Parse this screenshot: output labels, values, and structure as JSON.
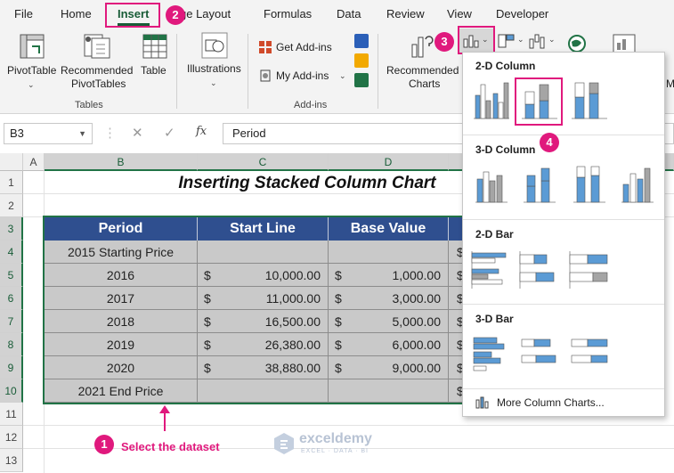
{
  "tabs": [
    "File",
    "Home",
    "Insert",
    "ge Layout",
    "Formulas",
    "Data",
    "Review",
    "View",
    "Developer"
  ],
  "ribbon": {
    "pivot_table": "PivotTable",
    "recommended_pivot": [
      "Recommended",
      "PivotTables"
    ],
    "table": "Table",
    "illustrations": "Illustrations",
    "get_addins": "Get Add-ins",
    "my_addins": "My Add-ins",
    "recommended_charts": [
      "Recommended",
      "Charts"
    ],
    "partial_label": "M",
    "group_tables": "Tables",
    "group_addins": "Add-ins"
  },
  "formula_bar": {
    "cell_ref": "B3",
    "value": "Period",
    "fx": "fx"
  },
  "grid": {
    "columns": [
      "A",
      "B",
      "C",
      "D"
    ],
    "rows": [
      "1",
      "2",
      "3",
      "4",
      "5",
      "6",
      "7",
      "8",
      "9",
      "10",
      "11",
      "12",
      "13"
    ],
    "title": "Inserting Stacked Column Chart"
  },
  "table": {
    "headers": [
      "Period",
      "Start Line",
      "Base Value"
    ],
    "currency": "$",
    "rows": [
      {
        "period": "2015 Starting Price",
        "start": "",
        "base": ""
      },
      {
        "period": "2016",
        "start": "10,000.00",
        "base": "1,000.00"
      },
      {
        "period": "2017",
        "start": "11,000.00",
        "base": "3,000.00"
      },
      {
        "period": "2018",
        "start": "16,500.00",
        "base": "5,000.00"
      },
      {
        "period": "2019",
        "start": "26,380.00",
        "base": "6,000.00"
      },
      {
        "period": "2020",
        "start": "38,880.00",
        "base": "9,000.00"
      },
      {
        "period": "2021 End Price",
        "start": "",
        "base": ""
      }
    ]
  },
  "dropdown": {
    "sections": [
      "2-D Column",
      "3-D Column",
      "2-D Bar",
      "3-D Bar"
    ],
    "more": "More Column Charts..."
  },
  "callouts": {
    "badges": [
      "1",
      "2",
      "3",
      "4"
    ],
    "note": "Select the dataset"
  },
  "watermark": {
    "name": "exceldemy",
    "tagline": "EXCEL · DATA · BI"
  },
  "colors": {
    "accent": "#185c37",
    "header_fill": "#2f4f8f",
    "cell_fill": "#c9c9c9",
    "callout": "#e0197d",
    "chart_blue": "#5b9bd5",
    "chart_gray": "#a5a5a5"
  }
}
